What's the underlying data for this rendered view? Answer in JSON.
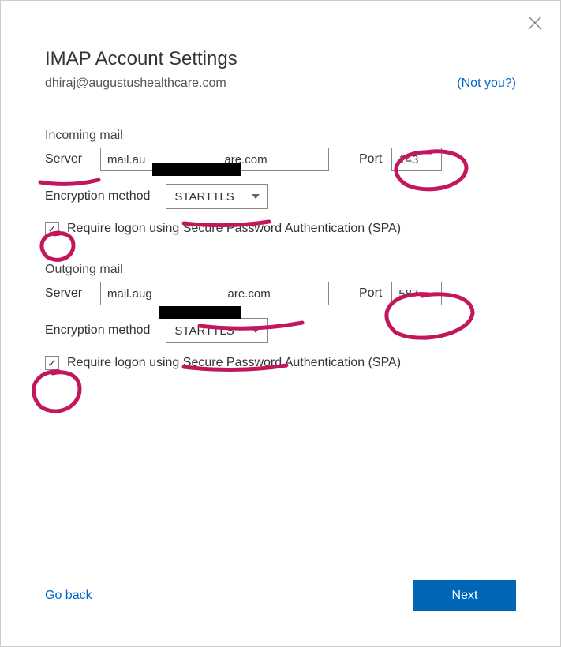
{
  "title": "IMAP Account Settings",
  "email": "dhiraj@augustushealthcare.com",
  "not_you": "(Not you?)",
  "incoming": {
    "heading": "Incoming mail",
    "server_label": "Server",
    "server_value": "mail.au                        are.com",
    "port_label": "Port",
    "port_value": "143",
    "encryption_label": "Encryption method",
    "encryption_value": "STARTTLS",
    "spa_label": "Require logon using Secure Password Authentication (SPA)",
    "spa_checked": true
  },
  "outgoing": {
    "heading": "Outgoing mail",
    "server_label": "Server",
    "server_value": "mail.aug                       are.com",
    "port_label": "Port",
    "port_value": "587",
    "encryption_label": "Encryption method",
    "encryption_value": "STARTTLS",
    "spa_label": "Require logon using Secure Password Authentication (SPA)",
    "spa_checked": true
  },
  "go_back": "Go back",
  "next": "Next",
  "annotation_color": "#c2185b"
}
